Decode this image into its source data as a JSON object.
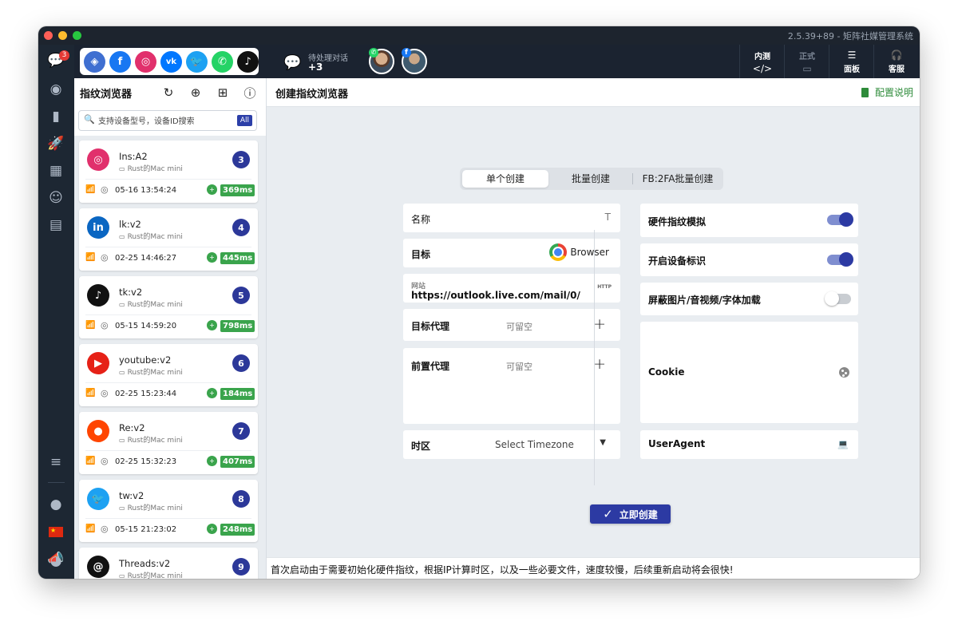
{
  "window": {
    "title": "2.5.39+89 - 矩阵社媒管理系统"
  },
  "leftbar": {
    "badge": "3",
    "icons": [
      "chat-bubbles-icon",
      "browser-icon",
      "phone-icon",
      "rocket-icon",
      "store-icon",
      "brain-icon",
      "film-icon",
      "server-icon",
      "theme-toggle-icon",
      "china-flag-icon",
      "megaphone-icon",
      "user-account-icon"
    ]
  },
  "topbar": {
    "social": [
      {
        "name": "multi-platform",
        "color": "#3f6fd1",
        "glyph": "◈"
      },
      {
        "name": "facebook",
        "color": "#1877f2",
        "glyph": "f"
      },
      {
        "name": "instagram",
        "color": "#e1306c",
        "glyph": "◎"
      },
      {
        "name": "vk",
        "color": "#0077ff",
        "glyph": "vk"
      },
      {
        "name": "twitter",
        "color": "#1da1f2",
        "glyph": "🐦"
      },
      {
        "name": "whatsapp",
        "color": "#25d366",
        "glyph": "✆"
      },
      {
        "name": "tiktok",
        "color": "#111111",
        "glyph": "♪"
      }
    ],
    "pending_label": "待处理对话",
    "pending_count": "+3",
    "right": [
      {
        "label": "内测",
        "sub": "</>",
        "active": true
      },
      {
        "label": "正式",
        "sub": "▭",
        "active": false
      },
      {
        "label": "面板",
        "sub": "☰",
        "active": true
      },
      {
        "label": "客服",
        "sub": "🎧",
        "active": true
      }
    ]
  },
  "list_panel": {
    "title": "指纹浏览器",
    "search_placeholder": "支持设备型号，设备ID搜索",
    "all_tag": "All",
    "cards": [
      {
        "name": "Ins:A2",
        "device": "Rust的Mac mini",
        "num": "3",
        "time": "05-16 13:54:24",
        "ping": "369ms",
        "logo": "instagram",
        "logo_color": "#e1306c",
        "glyph": "◎"
      },
      {
        "name": "lk:v2",
        "device": "Rust的Mac mini",
        "num": "4",
        "time": "02-25 14:46:27",
        "ping": "445ms",
        "logo": "linkedin",
        "logo_color": "#0a66c2",
        "glyph": "in"
      },
      {
        "name": "tk:v2",
        "device": "Rust的Mac mini",
        "num": "5",
        "time": "05-15 14:59:20",
        "ping": "798ms",
        "logo": "tiktok",
        "logo_color": "#111111",
        "glyph": "♪"
      },
      {
        "name": "youtube:v2",
        "device": "Rust的Mac mini",
        "num": "6",
        "time": "02-25 15:23:44",
        "ping": "184ms",
        "logo": "youtube",
        "logo_color": "#e62117",
        "glyph": "▶"
      },
      {
        "name": "Re:v2",
        "device": "Rust的Mac mini",
        "num": "7",
        "time": "02-25 15:32:23",
        "ping": "407ms",
        "logo": "reddit",
        "logo_color": "#ff4500",
        "glyph": "●"
      },
      {
        "name": "tw:v2",
        "device": "Rust的Mac mini",
        "num": "8",
        "time": "05-15 21:23:02",
        "ping": "248ms",
        "logo": "twitter",
        "logo_color": "#1da1f2",
        "glyph": "🐦"
      },
      {
        "name": "Threads:v2",
        "device": "Rust的Mac mini",
        "num": "9",
        "time": "",
        "ping": "",
        "logo": "threads",
        "logo_color": "#111111",
        "glyph": "@"
      }
    ]
  },
  "main": {
    "title": "创建指纹浏览器",
    "config_link": "配置说明",
    "tabs": [
      {
        "label": "单个创建",
        "active": true
      },
      {
        "label": "批量创建",
        "active": false
      },
      {
        "label": "FB:2FA批量创建",
        "active": false
      }
    ],
    "form": {
      "name_label": "名称",
      "target_label": "目标",
      "target_value": "Browser",
      "url_label": "网站",
      "url_value": "https://outlook.live.com/mail/0/",
      "url_tag": "HTTP",
      "target_proxy_label": "目标代理",
      "target_proxy_hint": "可留空",
      "pre_proxy_label": "前置代理",
      "pre_proxy_hint": "可留空",
      "timezone_label": "时区",
      "timezone_value": "Select Timezone"
    },
    "options": [
      {
        "label": "硬件指纹模拟",
        "enabled": true
      },
      {
        "label": "开启设备标识",
        "enabled": true
      },
      {
        "label": "屏蔽图片/音视频/字体加载",
        "enabled": false
      }
    ],
    "cookie_label": "Cookie",
    "useragent_label": "UserAgent",
    "create_button": "立即创建",
    "footer_note": "首次启动由于需要初始化硬件指纹，根据IP计算时区，以及一些必要文件，速度较慢，后续重新启动将会很快!"
  }
}
